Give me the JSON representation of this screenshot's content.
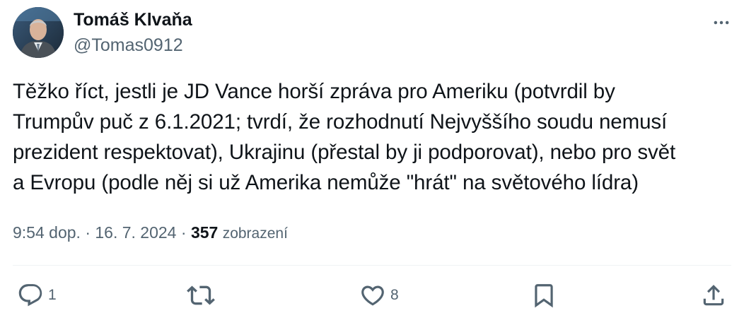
{
  "author": {
    "display_name": "Tomáš Klvaňa",
    "handle": "@Tomas0912"
  },
  "tweet": {
    "text": "Těžko říct, jestli je JD Vance horší zpráva pro Ameriku (potvrdil by\nTrumpův puč z 6.1.2021; tvrdí, že rozhodnutí Nejvyššího soudu nemusí\nprezident respektovat), Ukrajinu (přestal by ji podporovat), nebo pro svět\na Evropu (podle něj si už Amerika nemůže \"hrát\" na světového lídra)",
    "time": "9:54 dop.",
    "separator": "·",
    "date": "16. 7. 2024",
    "views_count": "357",
    "views_label": "zobrazení"
  },
  "actions": {
    "reply_count": "1",
    "like_count": "8"
  },
  "icons": {
    "more": "more-horizontal-icon",
    "reply": "reply-bubble-icon",
    "retweet": "retweet-arrows-icon",
    "like": "heart-icon",
    "bookmark": "bookmark-icon",
    "share": "share-upload-icon"
  },
  "colors": {
    "text_primary": "#0f1419",
    "text_secondary": "#536471",
    "divider": "#eff3f4"
  }
}
